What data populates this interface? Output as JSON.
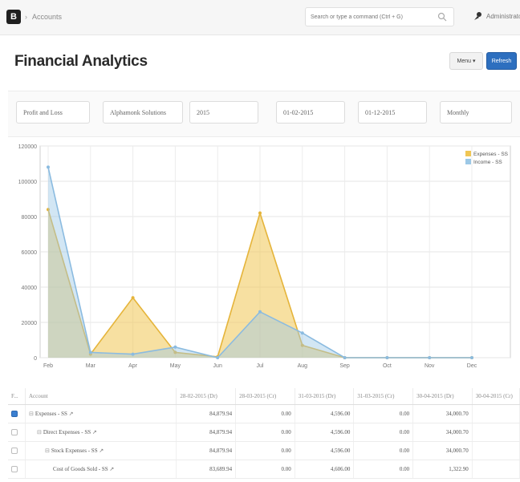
{
  "topbar": {
    "logo_glyph": "B",
    "breadcrumb_sep": "›",
    "breadcrumb": "Accounts",
    "search_placeholder": "Search or type a command (Ctrl + G)",
    "user": "Administrator"
  },
  "page": {
    "title": "Financial Analytics",
    "menu_label": "Menu",
    "menu_caret": "▾",
    "refresh_label": "Refresh"
  },
  "filters": {
    "report_type": "Profit and Loss",
    "company": "Alphamonk Solutions",
    "fiscal_year": "2015",
    "from_date": "01-02-2015",
    "to_date": "01-12-2015",
    "periodicity": "Monthly"
  },
  "chart_data": {
    "type": "area",
    "x": [
      "Feb",
      "Mar",
      "Apr",
      "May",
      "Jun",
      "Jul",
      "Aug",
      "Sep",
      "Oct",
      "Nov",
      "Dec"
    ],
    "y_ticks": [
      "120000",
      "100000",
      "80000",
      "60000",
      "40000",
      "20000",
      "0"
    ],
    "ylim": [
      0,
      120000
    ],
    "series": [
      {
        "name": "Expenses - SS",
        "color": "#f0c654",
        "values": [
          84000,
          2000,
          34000,
          3000,
          500,
          82000,
          7000,
          0,
          0,
          0,
          0
        ]
      },
      {
        "name": "Income - SS",
        "color": "#9cc8e6",
        "values": [
          108000,
          3000,
          2000,
          6000,
          0,
          26000,
          14000,
          0,
          0,
          0,
          0
        ]
      }
    ],
    "legend_position": "top-right",
    "grid": true
  },
  "table": {
    "columns": [
      "F...",
      "Account",
      "28-02-2015 (Dr)",
      "28-03-2015 (Cr)",
      "31-03-2015 (Dr)",
      "31-03-2015 (Cr)",
      "30-04-2015 (Dr)",
      "30-04-2015 (Cr)"
    ],
    "rows": [
      {
        "checked": true,
        "indent": 0,
        "toggle": "⊟",
        "account": "Expenses - SS",
        "values": [
          "84,879.94",
          "0.00",
          "4,596.00",
          "0.00",
          "34,000.70"
        ]
      },
      {
        "checked": false,
        "indent": 1,
        "toggle": "⊟",
        "account": "Direct Expenses - SS",
        "values": [
          "84,879.94",
          "0.00",
          "4,596.00",
          "0.00",
          "34,000.70"
        ]
      },
      {
        "checked": false,
        "indent": 2,
        "toggle": "⊟",
        "account": "Stock Expenses - SS",
        "values": [
          "84,879.94",
          "0.00",
          "4,596.00",
          "0.00",
          "34,000.70"
        ]
      },
      {
        "checked": false,
        "indent": 3,
        "toggle": "",
        "account": "Cost of Goods Sold - SS",
        "values": [
          "83,689.94",
          "0.00",
          "4,606.00",
          "0.00",
          "1,322.90"
        ]
      }
    ]
  }
}
